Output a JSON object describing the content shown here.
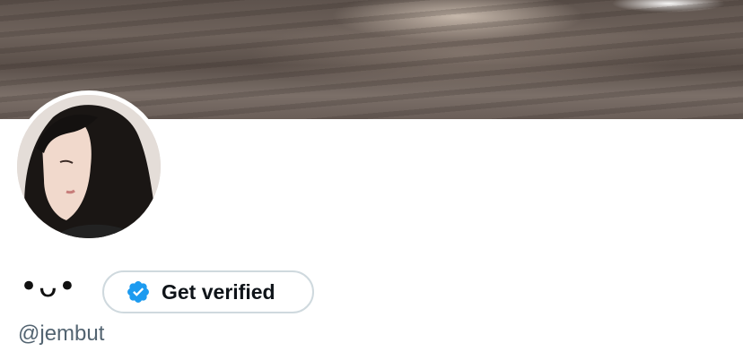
{
  "profile": {
    "display_name": "•ᴗ•",
    "verify_label": "Get verified",
    "handle": "@jembut"
  },
  "icons": {
    "verify": "verified-badge-icon"
  },
  "colors": {
    "verified_blue": "#1d9bf0",
    "handle_gray": "#536471",
    "border": "#cfd9de"
  }
}
